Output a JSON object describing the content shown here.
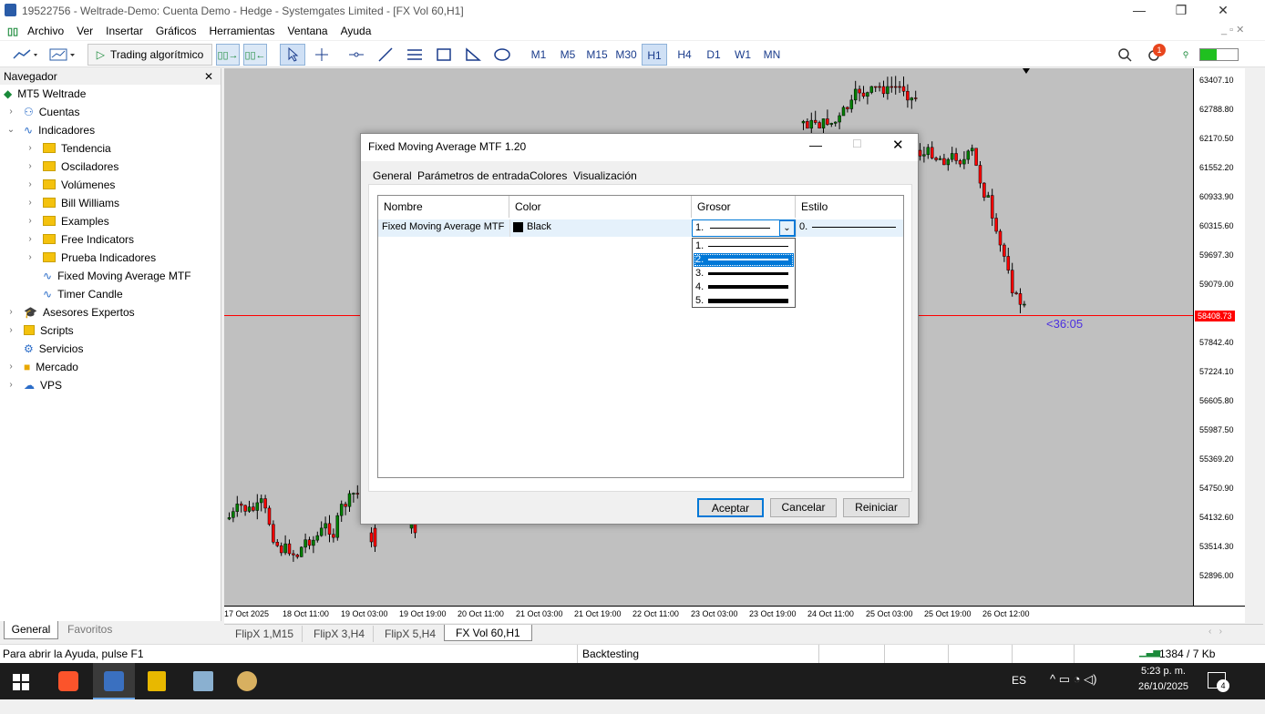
{
  "window": {
    "title": "19522756 - Weltrade-Demo: Cuenta Demo - Hedge - Systemgates Limited - [FX Vol 60,H1]",
    "minimize": "—",
    "restore": "❐",
    "close": "✕"
  },
  "menu": [
    "Archivo",
    "Ver",
    "Insertar",
    "Gráficos",
    "Herramientas",
    "Ventana",
    "Ayuda"
  ],
  "toolbar": {
    "algo_trading": "Trading algorítmico",
    "timeframes": [
      "M1",
      "M5",
      "M15",
      "M30",
      "H1",
      "H4",
      "D1",
      "W1",
      "MN"
    ],
    "active_timeframe": "H1",
    "notif_count": "1"
  },
  "navigator": {
    "title": "Navegador",
    "close": "✕",
    "root": "MT5 Weltrade",
    "items": [
      {
        "label": "Cuentas"
      },
      {
        "label": "Indicadores"
      },
      {
        "label": "Tendencia"
      },
      {
        "label": "Osciladores"
      },
      {
        "label": "Volúmenes"
      },
      {
        "label": "Bill Williams"
      },
      {
        "label": "Examples"
      },
      {
        "label": "Free Indicators"
      },
      {
        "label": "Prueba Indicadores"
      },
      {
        "label": "Fixed Moving Average MTF"
      },
      {
        "label": "Timer Candle"
      },
      {
        "label": "Asesores Expertos"
      },
      {
        "label": "Scripts"
      },
      {
        "label": "Servicios"
      },
      {
        "label": "Mercado"
      },
      {
        "label": "VPS"
      }
    ],
    "tabs": [
      "General",
      "Favoritos"
    ]
  },
  "chart": {
    "timer": "<36:05",
    "price_label": "58408.73",
    "y_ticks": [
      "63407.10",
      "62788.80",
      "62170.50",
      "61552.20",
      "60933.90",
      "60315.60",
      "59697.30",
      "59079.00",
      "57842.40",
      "57224.10",
      "56605.80",
      "55987.50",
      "55369.20",
      "54750.90",
      "54132.60",
      "53514.30",
      "52896.00"
    ],
    "x_ticks": [
      "17 Oct 2025",
      "18 Oct 11:00",
      "19 Oct 03:00",
      "19 Oct 19:00",
      "20 Oct 11:00",
      "21 Oct 03:00",
      "21 Oct 19:00",
      "22 Oct 11:00",
      "23 Oct 03:00",
      "23 Oct 19:00",
      "24 Oct 11:00",
      "25 Oct 03:00",
      "25 Oct 19:00",
      "26 Oct 12:00"
    ],
    "tabs": [
      "FlipX 1,M15",
      "FlipX 3,H4",
      "FlipX 5,H4",
      "FX Vol 60,H1"
    ],
    "active_tab": "FX Vol 60,H1",
    "colors": {
      "bull": "#008000",
      "bear": "#ff0000",
      "bg": "#c0c0c0",
      "price_line": "#ff0000",
      "timer": "#4b2ee0"
    }
  },
  "dialog": {
    "title": "Fixed Moving Average MTF 1.20",
    "tabs": [
      "General",
      "Parámetros de entrada",
      "Colores",
      "Visualización"
    ],
    "active_tab": "Colores",
    "columns": [
      "Nombre",
      "Color",
      "Grosor",
      "Estilo"
    ],
    "row": {
      "name": "Fixed Moving Average MTF",
      "color_name": "Black",
      "color_hex": "#000000",
      "grosor": "1.",
      "estilo": "0."
    },
    "dropdown_options": [
      "1.",
      "2.",
      "3.",
      "4.",
      "5."
    ],
    "dropdown_selected": "2.",
    "buttons": {
      "accept": "Aceptar",
      "cancel": "Cancelar",
      "reset": "Reiniciar"
    }
  },
  "status": {
    "help": "Para abrir la Ayuda, pulse F1",
    "mode": "Backtesting",
    "traffic": "1384 / 7 Kb"
  },
  "taskbar": {
    "lang": "ES",
    "time": "5:23 p. m.",
    "date": "26/10/2025",
    "notif_count": "4"
  }
}
